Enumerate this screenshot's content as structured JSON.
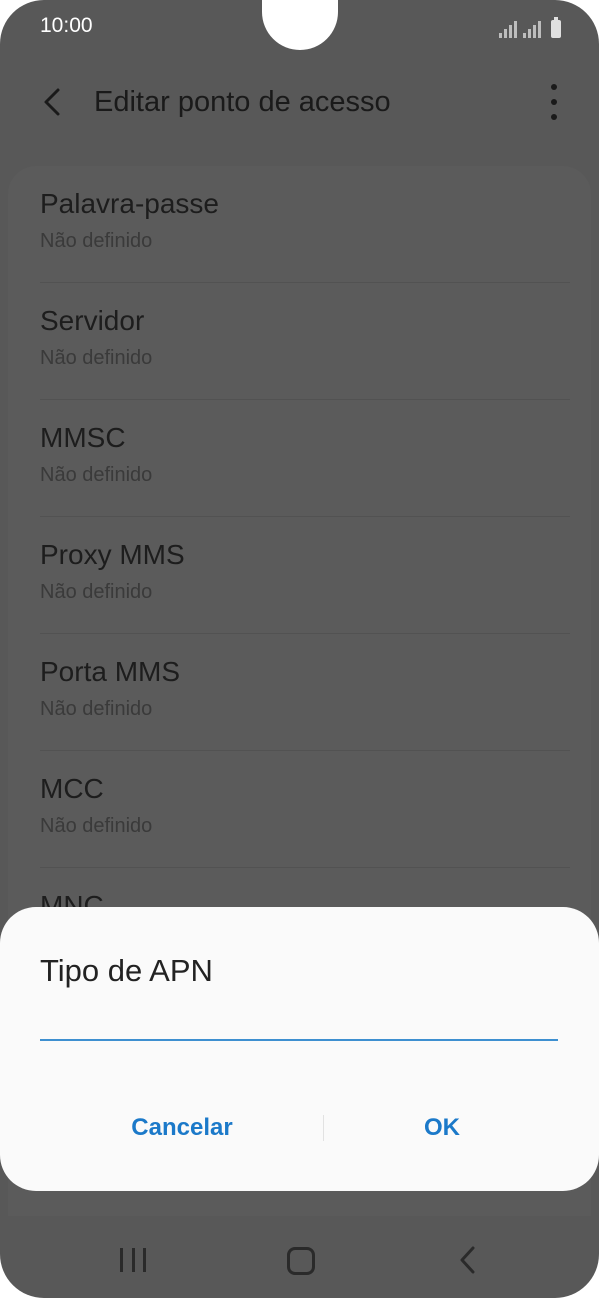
{
  "status_bar": {
    "time": "10:00",
    "icons": [
      "signal-icon",
      "signal-icon",
      "battery-icon"
    ]
  },
  "app_bar": {
    "title": "Editar ponto de acesso",
    "back_icon": "back-arrow-icon",
    "more_icon": "more-vertical-icon"
  },
  "settings_list": [
    {
      "title": "Palavra-passe",
      "value": "Não definido"
    },
    {
      "title": "Servidor",
      "value": "Não definido"
    },
    {
      "title": "MMSC",
      "value": "Não definido"
    },
    {
      "title": "Proxy MMS",
      "value": "Não definido"
    },
    {
      "title": "Porta MMS",
      "value": "Não definido"
    },
    {
      "title": "MCC",
      "value": "Não definido"
    },
    {
      "title": "MNC",
      "value": ""
    }
  ],
  "dialog": {
    "title": "Tipo de APN",
    "input_value": "",
    "cancel_label": "Cancelar",
    "ok_label": "OK"
  },
  "nav_bar": {
    "icons": [
      "recents-icon",
      "home-icon",
      "back-icon"
    ]
  },
  "colors": {
    "accent": "#1b79c9",
    "input_underline": "#3d8fd0",
    "scrim_background": "#585858",
    "dialog_background": "#fafafa"
  }
}
